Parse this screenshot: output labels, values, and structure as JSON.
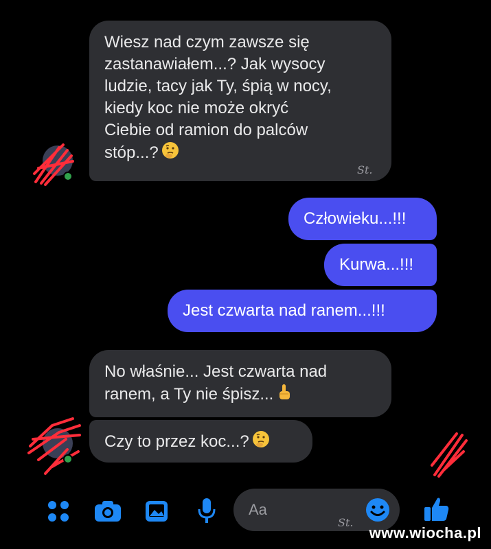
{
  "thread": {
    "messages": [
      {
        "sender": "other",
        "text": "Wiesz nad czym zawsze się\nzastanawiałem...? Jak wysocy\nludzie, tacy jak Ty, śpią w nocy,\nkiedy koc nie może okryć\nCiebie od ramion do palców\nstóp...?",
        "emoji": "thinking-face"
      },
      {
        "sender": "me",
        "text": "Człowieku...!!!"
      },
      {
        "sender": "me",
        "text": "Kurwa...!!!"
      },
      {
        "sender": "me",
        "text": "Jest czwarta nad ranem...!!!"
      },
      {
        "sender": "other",
        "text": "No właśnie... Jest czwarta nad\nranem, a Ty nie śpisz...",
        "emoji": "pointing-up-hand"
      },
      {
        "sender": "other",
        "text": "Czy to przez koc...?",
        "emoji": "thinking-face"
      }
    ]
  },
  "composer": {
    "placeholder": "Aa",
    "icons": [
      "menu-dots-icon",
      "camera-icon",
      "gallery-icon",
      "microphone-icon",
      "smiley-icon",
      "thumbs-up-icon"
    ]
  },
  "watermark": "www.wiocha.pl",
  "signature": "St.",
  "colors": {
    "incoming_bubble": "#2e2f33",
    "outgoing_bubble": "#4a4ef0",
    "accent": "#1e88f5",
    "background": "#000000"
  }
}
